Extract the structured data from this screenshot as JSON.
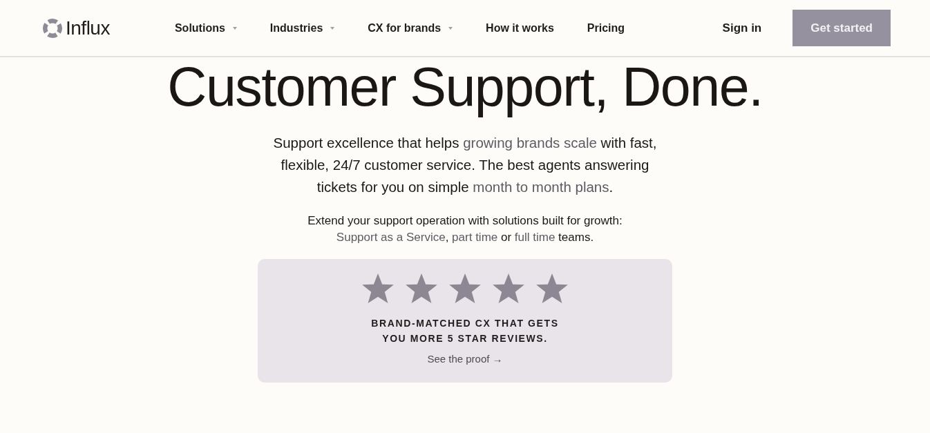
{
  "header": {
    "logo": {
      "text": "Influx"
    },
    "nav": [
      {
        "label": "Solutions",
        "dropdown": true
      },
      {
        "label": "Industries",
        "dropdown": true
      },
      {
        "label": "CX for brands",
        "dropdown": true
      },
      {
        "label": "How it works",
        "dropdown": false
      },
      {
        "label": "Pricing",
        "dropdown": false
      }
    ],
    "sign_in": "Sign in",
    "cta": "Get started"
  },
  "hero": {
    "title": "Customer Support, Done.",
    "intro": [
      {
        "kind": "text",
        "text": "Support excellence that helps "
      },
      {
        "kind": "link",
        "text": "growing brands scale"
      },
      {
        "kind": "text",
        "text": " with fast, flexible, 24/7 customer service. The best agents answering tickets for you on simple "
      },
      {
        "kind": "link",
        "text": "month to month plans"
      },
      {
        "kind": "text",
        "text": "."
      }
    ],
    "extend": [
      {
        "kind": "text",
        "text": "Extend your support operation with solutions built for growth: "
      },
      {
        "kind": "link",
        "text": "Support as a Service"
      },
      {
        "kind": "text",
        "text": ", "
      },
      {
        "kind": "link",
        "text": "part time"
      },
      {
        "kind": "text",
        "text": " or "
      },
      {
        "kind": "link",
        "text": "full time"
      },
      {
        "kind": "text",
        "text": " teams."
      }
    ]
  },
  "review_card": {
    "stars": 5,
    "headline": "BRAND-MATCHED CX THAT GETS YOU MORE 5 STAR REVIEWS.",
    "link": "See the proof →"
  }
}
